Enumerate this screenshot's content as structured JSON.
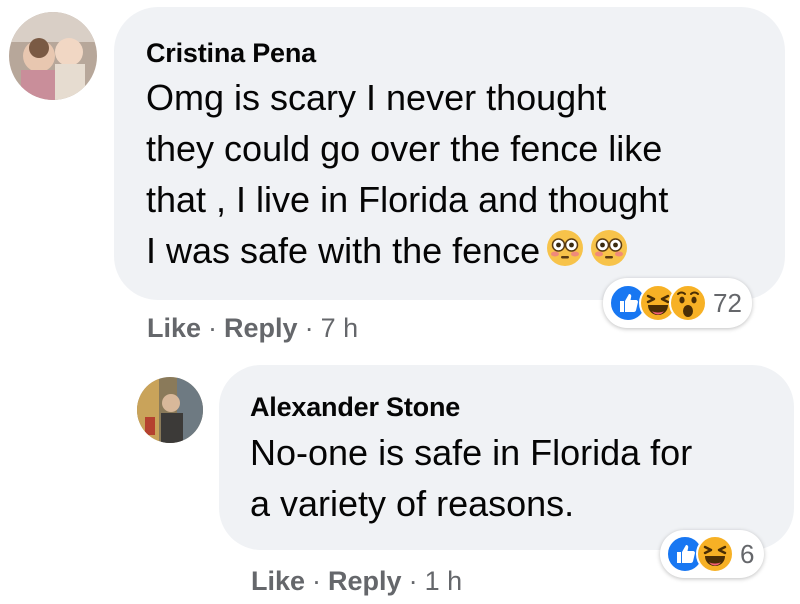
{
  "comments": [
    {
      "author": "Cristina Pena",
      "lines": [
        "Omg is scary I never thought",
        "they could go over the fence like",
        "that , I live in Florida and thought",
        "I was safe with the fence"
      ],
      "inline_emojis": [
        "flushed-face-emoji",
        "flushed-face-emoji"
      ],
      "reactions": [
        "like",
        "haha",
        "wow"
      ],
      "reaction_count": "72",
      "actions": {
        "like": "Like",
        "sep": "·",
        "reply": "Reply",
        "time": "7 h"
      }
    },
    {
      "author": "Alexander Stone",
      "lines": [
        "No-one is safe in Florida for",
        "a variety of reasons."
      ],
      "reactions": [
        "like",
        "haha"
      ],
      "reaction_count": "6",
      "actions": {
        "like": "Like",
        "sep": "·",
        "reply": "Reply",
        "time": "1 h"
      }
    }
  ],
  "colors": {
    "bubble": "#f0f2f5",
    "text": "#050505",
    "meta": "#65676b",
    "like_blue": "#1877f2",
    "reaction_yellow": "#f7b125"
  }
}
